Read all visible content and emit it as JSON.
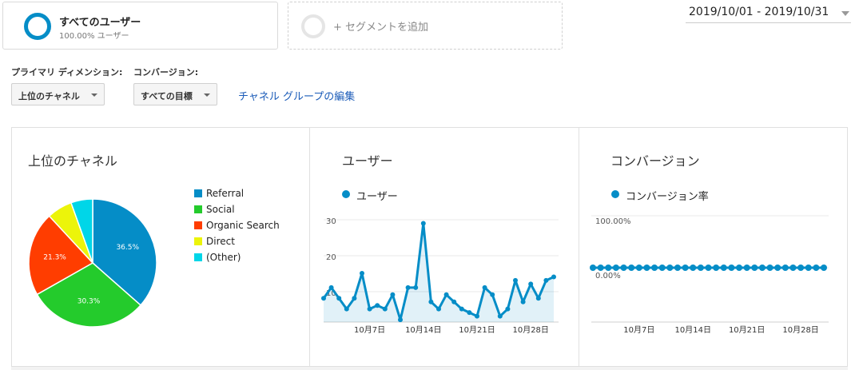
{
  "segment": {
    "name": "すべてのユーザー",
    "percent": "100.00% ユーザー",
    "add_label": "+ セグメントを追加"
  },
  "date_range": "2019/10/01 - 2019/10/31",
  "primary_dimension": {
    "label": "プライマリ ディメンション:",
    "value": "上位のチャネル"
  },
  "conversion": {
    "label": "コンバージョン:",
    "value": "すべての目標"
  },
  "edit_channel_group": "チャネル グループの編集",
  "panels": {
    "channels": "上位のチャネル",
    "users": "ユーザー",
    "conversions": "コンバージョン"
  },
  "legends": {
    "users_series": "ユーザー",
    "conversion_series": "コンバージョン率"
  },
  "colors": {
    "accent": "#058dc7",
    "social": "#24cb2c",
    "organic": "#ff3d00",
    "direct": "#ecf40a",
    "other": "#00d6e8"
  },
  "chart_data": [
    {
      "type": "pie",
      "title": "上位のチャネル",
      "categories": [
        "Referral",
        "Social",
        "Organic Search",
        "Direct",
        "(Other)"
      ],
      "values": [
        36.5,
        30.3,
        21.3,
        6.4,
        5.5
      ],
      "labels_shown": [
        "36.5%",
        "30.3%",
        "21.3%",
        "",
        ""
      ],
      "colors": [
        "#058dc7",
        "#24cb2c",
        "#ff3d00",
        "#ecf40a",
        "#00d6e8"
      ],
      "legend": "right"
    },
    {
      "type": "area",
      "title": "ユーザー",
      "x": [
        "10/1",
        "10/2",
        "10/3",
        "10/4",
        "10/5",
        "10/6",
        "10/7",
        "10/8",
        "10/9",
        "10/10",
        "10/11",
        "10/12",
        "10/13",
        "10/14",
        "10/15",
        "10/16",
        "10/17",
        "10/18",
        "10/19",
        "10/20",
        "10/21",
        "10/22",
        "10/23",
        "10/24",
        "10/25",
        "10/26",
        "10/27",
        "10/28",
        "10/29",
        "10/30",
        "10/31"
      ],
      "series": [
        {
          "name": "ユーザー",
          "values": [
            8,
            11,
            8,
            5,
            8,
            15,
            5,
            6,
            5,
            9,
            2,
            11,
            11,
            29,
            7,
            5,
            9,
            7,
            5,
            4,
            3,
            11,
            9,
            3,
            5,
            13,
            7,
            12,
            8,
            13,
            14
          ]
        }
      ],
      "yticks": [
        "30",
        "20",
        "10"
      ],
      "ylim": [
        0,
        30
      ],
      "xticks": [
        "10月7日",
        "10月14日",
        "10月21日",
        "10月28日"
      ],
      "grid": true
    },
    {
      "type": "line",
      "title": "コンバージョン",
      "x": [
        "10/1",
        "10/2",
        "10/3",
        "10/4",
        "10/5",
        "10/6",
        "10/7",
        "10/8",
        "10/9",
        "10/10",
        "10/11",
        "10/12",
        "10/13",
        "10/14",
        "10/15",
        "10/16",
        "10/17",
        "10/18",
        "10/19",
        "10/20",
        "10/21",
        "10/22",
        "10/23",
        "10/24",
        "10/25",
        "10/26",
        "10/27",
        "10/28",
        "10/29",
        "10/30",
        "10/31"
      ],
      "series": [
        {
          "name": "コンバージョン率",
          "values": [
            0,
            0,
            0,
            0,
            0,
            0,
            0,
            0,
            0,
            0,
            0,
            0,
            0,
            0,
            0,
            0,
            0,
            0,
            0,
            0,
            0,
            0,
            0,
            0,
            0,
            0,
            0,
            0,
            0,
            0,
            0
          ]
        }
      ],
      "yticks": [
        "100.00%",
        "0.00%"
      ],
      "xticks": [
        "10月7日",
        "10月14日",
        "10月21日",
        "10月28日"
      ],
      "grid": true
    }
  ]
}
